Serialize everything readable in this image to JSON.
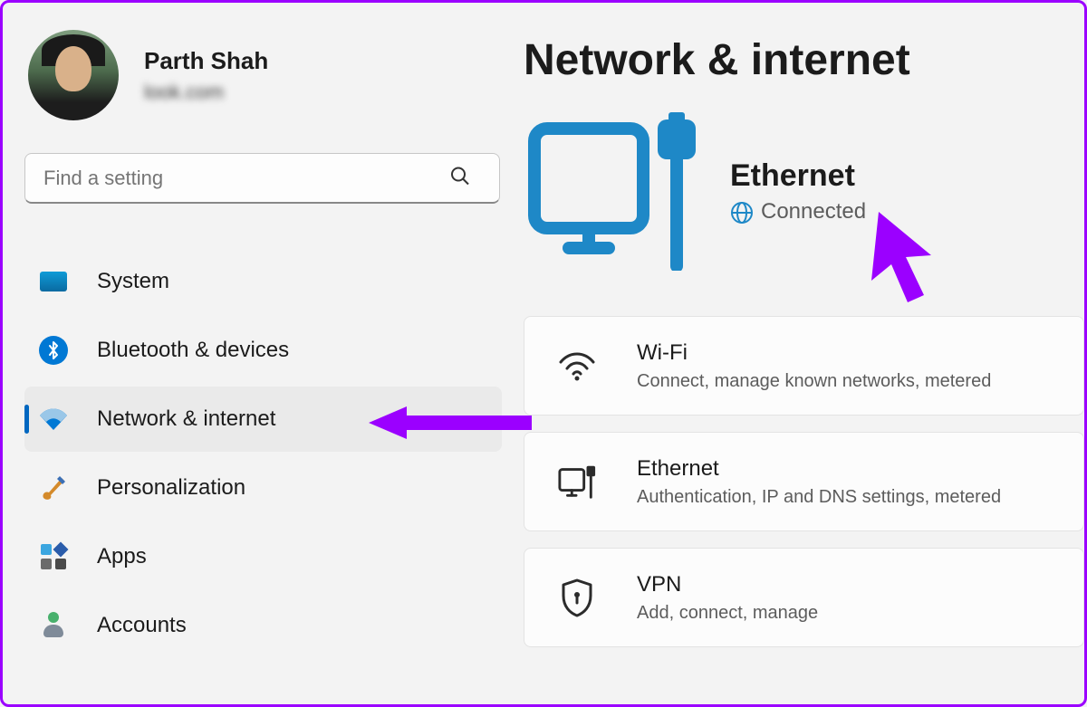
{
  "user": {
    "name": "Parth Shah",
    "email": "look.com"
  },
  "search": {
    "placeholder": "Find a setting"
  },
  "sidebar": {
    "items": [
      {
        "label": "System"
      },
      {
        "label": "Bluetooth & devices"
      },
      {
        "label": "Network & internet"
      },
      {
        "label": "Personalization"
      },
      {
        "label": "Apps"
      },
      {
        "label": "Accounts"
      }
    ]
  },
  "main": {
    "title": "Network & internet",
    "hero": {
      "name": "Ethernet",
      "status": "Connected"
    },
    "cards": [
      {
        "title": "Wi-Fi",
        "sub": "Connect, manage known networks, metered"
      },
      {
        "title": "Ethernet",
        "sub": "Authentication, IP and DNS settings, metered"
      },
      {
        "title": "VPN",
        "sub": "Add, connect, manage"
      }
    ]
  },
  "colors": {
    "accent": "#0078d4",
    "annotation": "#9b00ff"
  }
}
